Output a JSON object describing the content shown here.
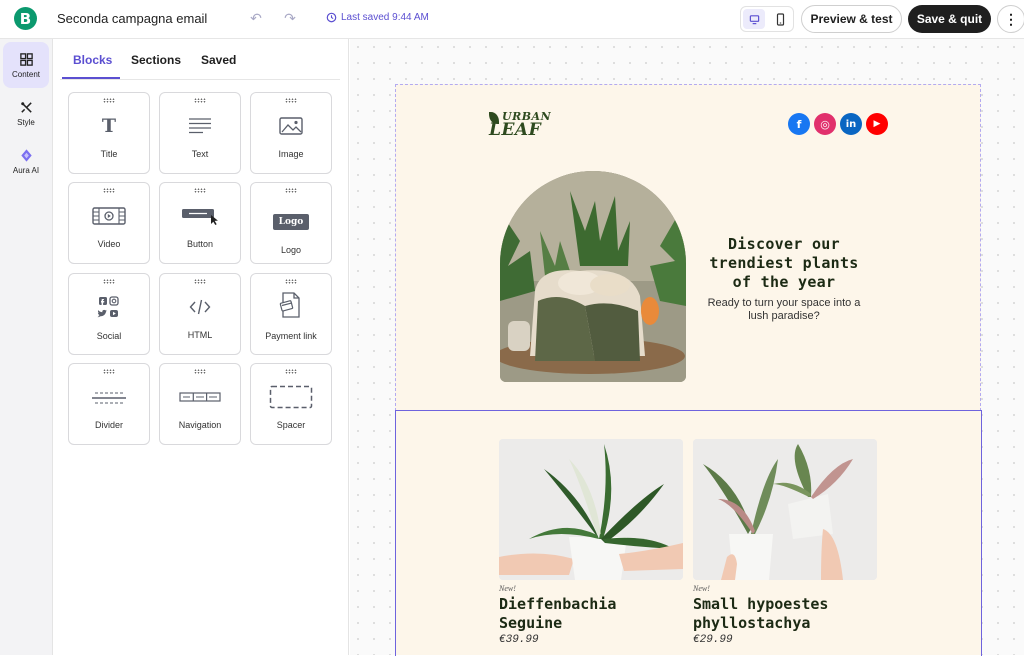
{
  "topbar": {
    "logo_letter": "B",
    "campaign_title": "Seconda campagna email",
    "last_saved": "Last saved 9:44 AM",
    "preview_label": "Preview & test",
    "save_label": "Save & quit",
    "more_label": "⋮"
  },
  "rail": {
    "items": [
      {
        "label": "Content",
        "icon": "grid-icon",
        "active": true
      },
      {
        "label": "Style",
        "icon": "brush-icon"
      },
      {
        "label": "Aura AI",
        "icon": "sparkle-icon"
      }
    ]
  },
  "panel": {
    "tabs": [
      {
        "label": "Blocks",
        "active": true
      },
      {
        "label": "Sections"
      },
      {
        "label": "Saved"
      }
    ],
    "blocks": [
      {
        "label": "Title",
        "icon": "title-icon"
      },
      {
        "label": "Text",
        "icon": "text-icon"
      },
      {
        "label": "Image",
        "icon": "image-icon"
      },
      {
        "label": "Video",
        "icon": "video-icon"
      },
      {
        "label": "Button",
        "icon": "button-icon"
      },
      {
        "label": "Logo",
        "icon": "logo-icon",
        "badge": "Logo"
      },
      {
        "label": "Social",
        "icon": "social-icon"
      },
      {
        "label": "HTML",
        "icon": "code-icon"
      },
      {
        "label": "Payment link",
        "icon": "payment-icon"
      },
      {
        "label": "Divider",
        "icon": "divider-icon"
      },
      {
        "label": "Navigation",
        "icon": "navigation-icon"
      },
      {
        "label": "Spacer",
        "icon": "spacer-icon"
      }
    ]
  },
  "email": {
    "brand_line1": "URBAN",
    "brand_line2": "LEAF",
    "socials": [
      {
        "name": "facebook-icon",
        "glyph": "f",
        "color": "#1877f2"
      },
      {
        "name": "instagram-icon",
        "glyph": "◎",
        "color": "#e1306c"
      },
      {
        "name": "linkedin-icon",
        "glyph": "in",
        "color": "#0a66c2"
      },
      {
        "name": "youtube-icon",
        "glyph": "▶",
        "color": "#ff0000"
      }
    ],
    "hero_heading": "Discover our trendiest plants of the year",
    "hero_sub": "Ready to turn your space into a lush paradise?",
    "products": [
      {
        "badge": "New!",
        "name": "Dieffenbachia Seguine",
        "price": "€39.99"
      },
      {
        "badge": "New!",
        "name": "Small hypoestes phyllostachya",
        "price": "€29.99"
      }
    ]
  },
  "colors": {
    "accent": "#5b4fd1",
    "brand_green": "#0b996e",
    "email_bg": "#fdf6ea",
    "heading_green": "#1c2a14"
  }
}
